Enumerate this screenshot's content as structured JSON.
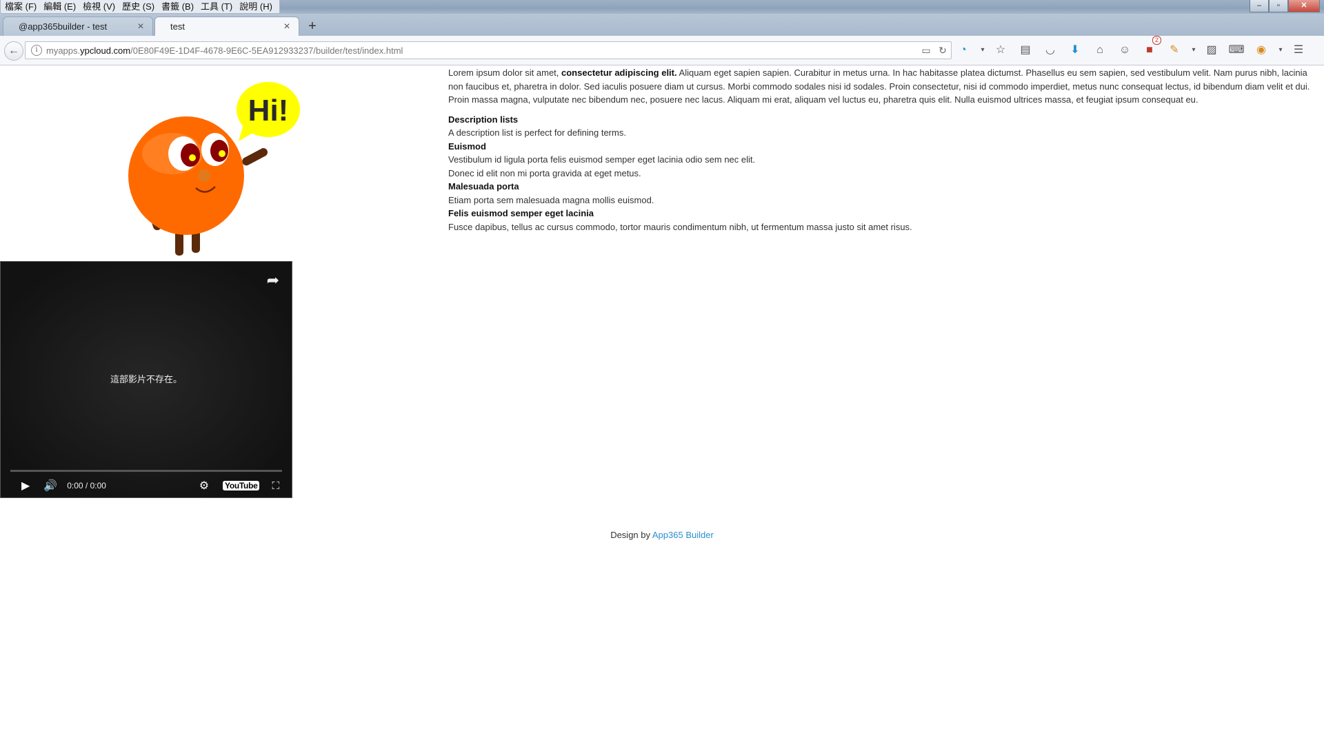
{
  "menubar": {
    "items": [
      "檔案 (F)",
      "編輯 (E)",
      "檢視 (V)",
      "歷史 (S)",
      "書籤 (B)",
      "工具 (T)",
      "說明 (H)"
    ]
  },
  "window_controls": {
    "minimize": "‒",
    "maximize": "▫",
    "close": "✕"
  },
  "tabs": [
    {
      "label": "@app365builder - test",
      "active": false
    },
    {
      "label": "test",
      "active": true
    }
  ],
  "tab_close_glyph": "×",
  "new_tab_glyph": "+",
  "navbar": {
    "back_glyph": "←",
    "info_glyph": "i",
    "url_prefix": "myapps.",
    "url_domain": "ypcloud.com",
    "url_path": "/0E80F49E-1D4F-4678-9E6C-5EA912933237/builder/test/index.html",
    "reader_glyph": "▭",
    "reload_glyph": "↻"
  },
  "toolbar_icons": [
    {
      "name": "skype-icon",
      "glyph": "◔",
      "style": "blue"
    },
    {
      "name": "dropdown-arrow-icon",
      "glyph": "▾",
      "style": "small"
    },
    {
      "name": "bookmark-star-icon",
      "glyph": "☆",
      "style": ""
    },
    {
      "name": "bookmarks-list-icon",
      "glyph": "▤",
      "style": ""
    },
    {
      "name": "pocket-icon",
      "glyph": "◡",
      "style": ""
    },
    {
      "name": "download-icon",
      "glyph": "⬇",
      "style": "blue"
    },
    {
      "name": "home-icon",
      "glyph": "⌂",
      "style": ""
    },
    {
      "name": "chat-icon",
      "glyph": "☺",
      "style": ""
    },
    {
      "name": "addon-icon",
      "glyph": "■",
      "style": "red",
      "badge": "2"
    },
    {
      "name": "extension-icon",
      "glyph": "✎",
      "style": "orange"
    },
    {
      "name": "dropdown-arrow-icon",
      "glyph": "▾",
      "style": "small"
    },
    {
      "name": "screenshot-icon",
      "glyph": "▨",
      "style": ""
    },
    {
      "name": "keyboard-icon",
      "glyph": "⌨",
      "style": ""
    },
    {
      "name": "vpn-icon",
      "glyph": "◉",
      "style": "orange"
    },
    {
      "name": "dropdown-arrow-icon",
      "glyph": "▾",
      "style": "small"
    },
    {
      "name": "menu-icon",
      "glyph": "☰",
      "style": ""
    }
  ],
  "mascot": {
    "speech": "Hi!",
    "body_color": "#ff6a00",
    "bubble_color": "#ffff00"
  },
  "video": {
    "share_glyph": "➦",
    "message": "這部影片不存在。",
    "play_glyph": "▶",
    "volume_glyph": "🔊",
    "time": "0:00 / 0:00",
    "settings_glyph": "⚙",
    "youtube_label": "YouTube",
    "fullscreen_glyph": "⛶"
  },
  "content": {
    "intro_plain": "Lorem ipsum dolor sit amet, ",
    "intro_bold": "consectetur adipiscing elit.",
    "intro_rest": " Aliquam eget sapien sapien. Curabitur in metus urna. In hac habitasse platea dictumst. Phasellus eu sem sapien, sed vestibulum velit. Nam purus nibh, lacinia non faucibus et, pharetra in dolor. Sed iaculis posuere diam ut cursus. Morbi commodo sodales nisi id sodales. Proin consectetur, nisi id commodo imperdiet, metus nunc consequat lectus, id bibendum diam velit et dui. Proin massa magna, vulputate nec bibendum nec, posuere nec lacus. Aliquam mi erat, aliquam vel luctus eu, pharetra quis elit. Nulla euismod ultrices massa, et feugiat ipsum consequat eu.",
    "dl": [
      {
        "title": "Description lists",
        "text": "A description list is perfect for defining terms."
      },
      {
        "title": "Euismod",
        "text": "Vestibulum id ligula porta felis euismod semper eget lacinia odio sem nec elit.",
        "text2": "Donec id elit non mi porta gravida at eget metus."
      },
      {
        "title": "Malesuada porta",
        "text": "Etiam porta sem malesuada magna mollis euismod."
      },
      {
        "title": "Felis euismod semper eget lacinia",
        "text": "Fusce dapibus, tellus ac cursus commodo, tortor mauris condimentum nibh, ut fermentum massa justo sit amet risus."
      }
    ]
  },
  "footer": {
    "prefix": "Design by ",
    "link": "App365 Builder",
    "link_color": "#2a8fcf"
  }
}
